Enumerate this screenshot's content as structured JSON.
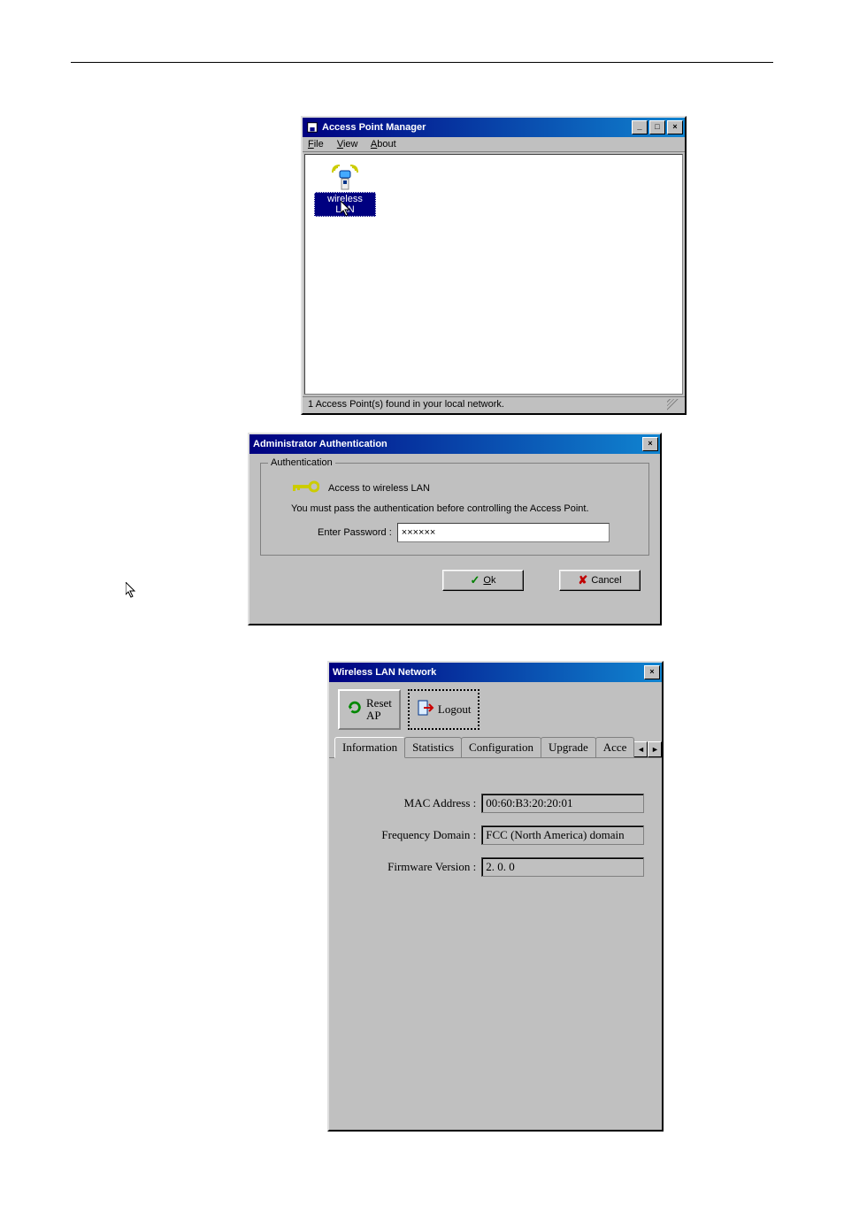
{
  "window1": {
    "title": "Access Point Manager",
    "menu": [
      "File",
      "View",
      "About"
    ],
    "icon_label": "wireless LAN",
    "status": "1 Access Point(s) found in your local network."
  },
  "dialog2": {
    "title": "Administrator Authentication",
    "group_label": "Authentication",
    "access_text": "Access to wireless LAN",
    "instruction": "You must pass the authentication before controlling the Access Point.",
    "password_label": "Enter Password :",
    "password_value": "××××××",
    "ok_label": "Ok",
    "cancel_label": "Cancel"
  },
  "window3": {
    "title": "Wireless LAN Network",
    "reset_label": "Reset AP",
    "logout_label": "Logout",
    "tabs": [
      "Information",
      "Statistics",
      "Configuration",
      "Upgrade",
      "Acce"
    ],
    "active_tab": 0,
    "fields": {
      "mac_label": "MAC Address :",
      "mac_value": "00:60:B3:20:20:01",
      "freq_label": "Frequency Domain :",
      "freq_value": "FCC (North America) domain",
      "fw_label": "Firmware Version :",
      "fw_value": "2. 0. 0"
    }
  }
}
